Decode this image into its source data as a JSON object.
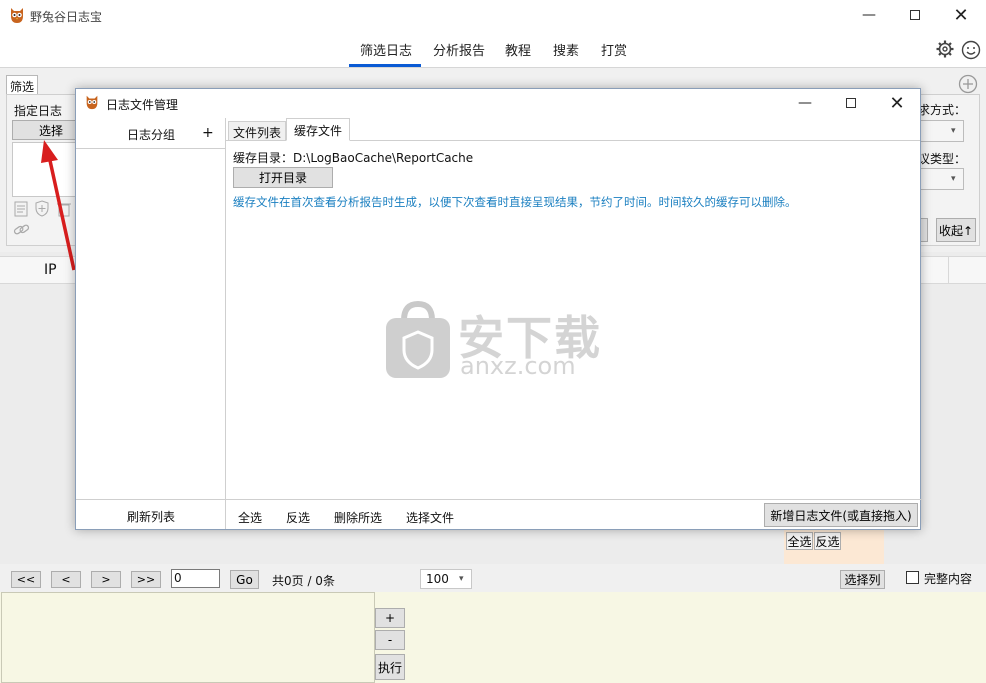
{
  "app": {
    "title": "野兔谷日志宝",
    "nav": [
      "筛选日志",
      "分析报告",
      "教程",
      "搜素",
      "打赏"
    ],
    "active_nav": 0
  },
  "bg": {
    "filter_tab": "筛选",
    "specify_log_label": "指定日志",
    "select_button": "选择",
    "sort_label": "求方式：",
    "type_label": "议类型：",
    "collapse_button": "收起↑",
    "ip_column": "IP",
    "select_all_small": "全选",
    "invert_small": "反选",
    "page_first": "<<",
    "page_prev": "<",
    "page_next": ">",
    "page_last": ">>",
    "page_input_value": "0",
    "go_button": "Go",
    "page_info": "共0页 / 0条",
    "page_size": "100",
    "select_columns_button": "选择列",
    "full_content_label": "完整内容",
    "plus_button": "+",
    "minus_button": "-",
    "execute_button": "执行"
  },
  "dialog": {
    "title": "日志文件管理",
    "group_header": "日志分组",
    "group_add": "+",
    "tabs": [
      "文件列表",
      "缓存文件"
    ],
    "active_tab": 1,
    "cache_dir_label": "缓存目录：D:\\LogBaoCache\\ReportCache",
    "open_dir_button": "打开目录",
    "info_text": "缓存文件在首次查看分析报告时生成，以便下次查看时直接呈现结果，节约了时间。时间较久的缓存可以删除。",
    "refresh_list": "刷新列表",
    "select_all": "全选",
    "invert_selection": "反选",
    "delete_selected": "删除所选",
    "select_files": "选择文件",
    "add_log_button": "新增日志文件(或直接拖入)"
  },
  "watermark": {
    "cn": "安下载",
    "en": "anxz.com"
  },
  "colors": {
    "accent": "#0a5ad4",
    "info_text": "#1a7fc0",
    "bottom_panel": "#f7f7e4"
  }
}
